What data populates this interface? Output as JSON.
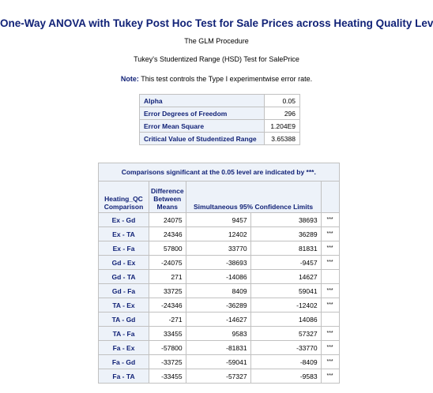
{
  "title": "One-Way ANOVA with Tukey Post Hoc Test for Sale Prices across Heating Quality Levels",
  "procedure": "The GLM Procedure",
  "subtitle": "Tukey's Studentized Range (HSD) Test for SalePrice",
  "note": {
    "label": "Note:",
    "text": "This test controls the Type I experimentwise error rate."
  },
  "stats": [
    {
      "label": "Alpha",
      "value": "0.05"
    },
    {
      "label": "Error Degrees of Freedom",
      "value": "296"
    },
    {
      "label": "Error Mean Square",
      "value": "1.204E9"
    },
    {
      "label": "Critical Value of Studentized Range",
      "value": "3.65388"
    }
  ],
  "comparisons": {
    "caption": "Comparisons significant at the 0.05 level are indicated by ***.",
    "headers": {
      "comparison": [
        "Heating_QC",
        "Comparison"
      ],
      "difference": [
        "Difference",
        "Between",
        "Means"
      ],
      "limits": "Simultaneous 95% Confidence Limits"
    },
    "rows": [
      {
        "cmp": "Ex - Gd",
        "diff": "24075",
        "lo": "9457",
        "hi": "38693",
        "sig": "***"
      },
      {
        "cmp": "Ex - TA",
        "diff": "24346",
        "lo": "12402",
        "hi": "36289",
        "sig": "***"
      },
      {
        "cmp": "Ex - Fa",
        "diff": "57800",
        "lo": "33770",
        "hi": "81831",
        "sig": "***"
      },
      {
        "cmp": "Gd - Ex",
        "diff": "-24075",
        "lo": "-38693",
        "hi": "-9457",
        "sig": "***"
      },
      {
        "cmp": "Gd - TA",
        "diff": "271",
        "lo": "-14086",
        "hi": "14627",
        "sig": ""
      },
      {
        "cmp": "Gd - Fa",
        "diff": "33725",
        "lo": "8409",
        "hi": "59041",
        "sig": "***"
      },
      {
        "cmp": "TA - Ex",
        "diff": "-24346",
        "lo": "-36289",
        "hi": "-12402",
        "sig": "***"
      },
      {
        "cmp": "TA - Gd",
        "diff": "-271",
        "lo": "-14627",
        "hi": "14086",
        "sig": ""
      },
      {
        "cmp": "TA - Fa",
        "diff": "33455",
        "lo": "9583",
        "hi": "57327",
        "sig": "***"
      },
      {
        "cmp": "Fa - Ex",
        "diff": "-57800",
        "lo": "-81831",
        "hi": "-33770",
        "sig": "***"
      },
      {
        "cmp": "Fa - Gd",
        "diff": "-33725",
        "lo": "-59041",
        "hi": "-8409",
        "sig": "***"
      },
      {
        "cmp": "Fa - TA",
        "diff": "-33455",
        "lo": "-57327",
        "hi": "-9583",
        "sig": "***"
      }
    ]
  }
}
